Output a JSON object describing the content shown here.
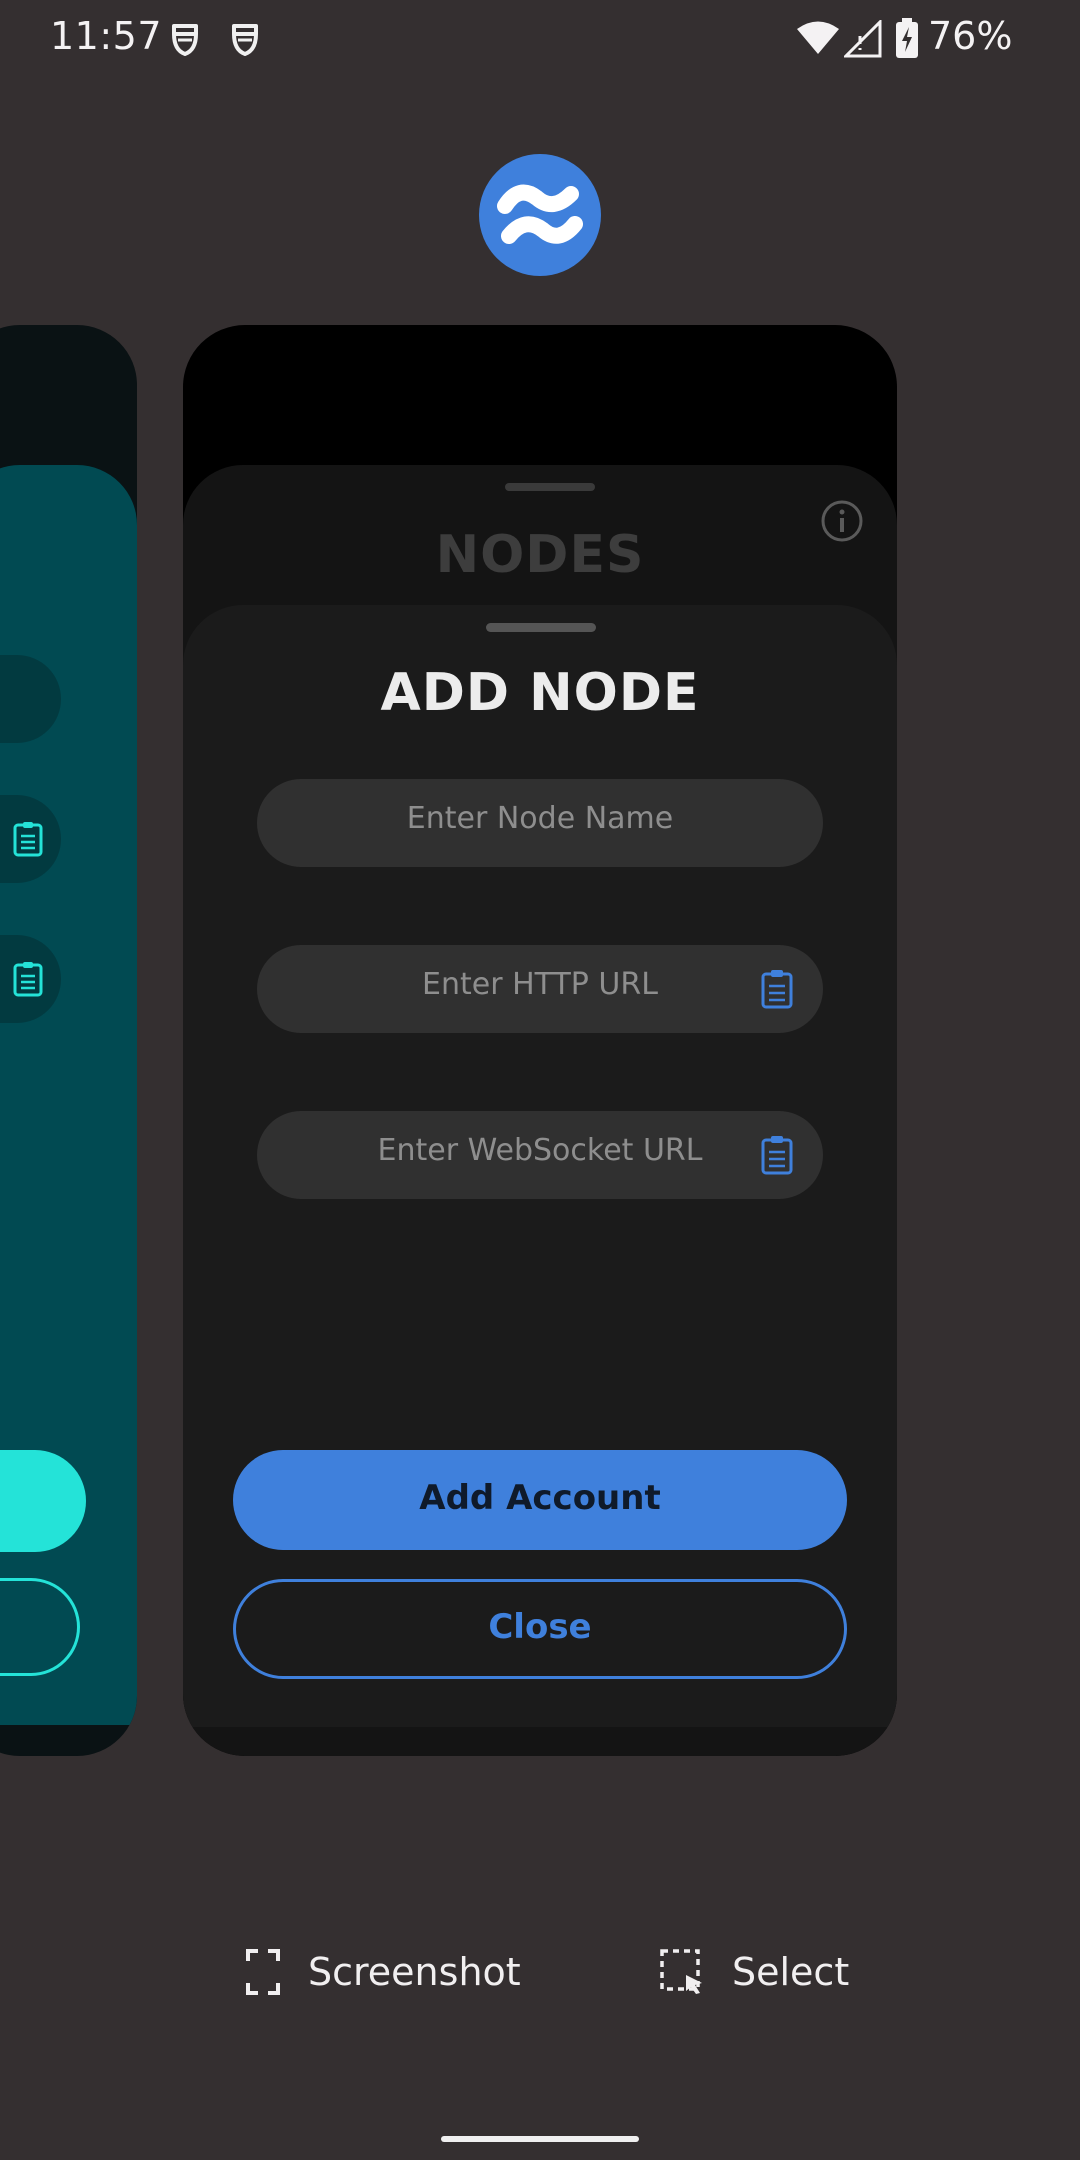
{
  "status_bar": {
    "time": "11:57",
    "notification_icons": [
      "carrier-app-icon",
      "carrier-app-icon"
    ],
    "battery_percent": "76%"
  },
  "app": {
    "icon": "celo-wallet-logo-icon"
  },
  "main_card": {
    "background_title": "NODES",
    "sheet": {
      "title": "ADD NODE",
      "fields": [
        {
          "placeholder": "Enter Node Name",
          "has_paste": false
        },
        {
          "placeholder": "Enter HTTP URL",
          "has_paste": true
        },
        {
          "placeholder": "Enter WebSocket URL",
          "has_paste": true
        }
      ],
      "primary_button": "Add Account",
      "secondary_button": "Close"
    }
  },
  "actions": {
    "screenshot_label": "Screenshot",
    "select_label": "Select"
  },
  "colors": {
    "accent": "#3F80DC",
    "teal": "#24E3D8",
    "recents_bg": "#342F30"
  }
}
